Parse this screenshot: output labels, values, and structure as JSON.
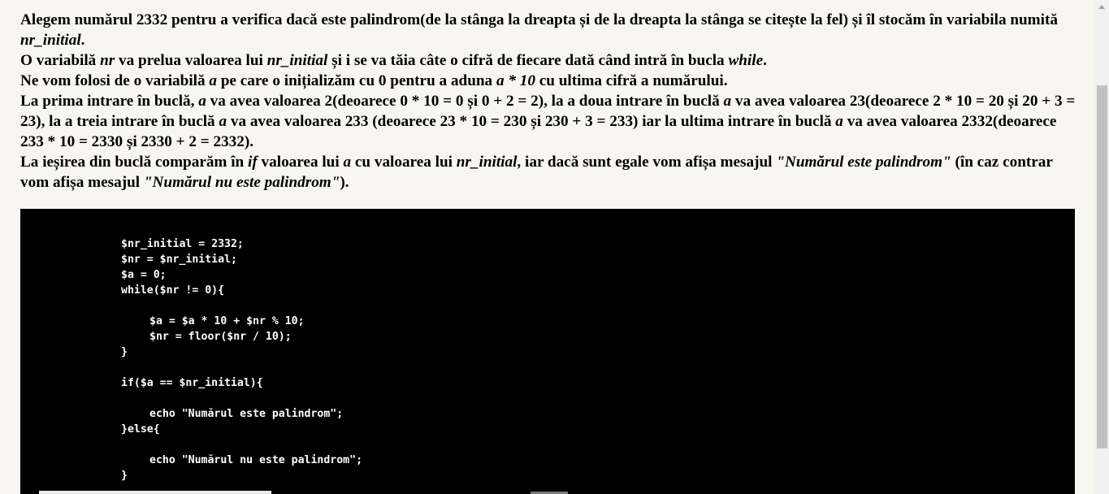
{
  "article": {
    "p1": {
      "a": "Alegem numărul 2332 pentru a verifica dacă este palindrom(de la stânga la dreapta și de la dreapta la stânga se citește la fel) și îl stocăm în variabila numită ",
      "b": "nr_initial",
      "c": "."
    },
    "p2": {
      "a": "O variabilă ",
      "b": "nr",
      "c": " va prelua valoarea lui ",
      "d": "nr_initial",
      "e": " și i se va tăia câte o cifră de fiecare dată când intră în bucla ",
      "f": "while",
      "g": "."
    },
    "p3": {
      "a": "Ne vom folosi de o variabilă ",
      "b": "a",
      "c": " pe care o inițializăm cu 0 pentru a aduna ",
      "d": "a * 10",
      "e": " cu ultima cifră a numărului."
    },
    "p4": {
      "a": "La prima intrare în buclă, ",
      "b": "a",
      "c": " va avea valoarea 2(deoarece 0 * 10 = 0 și 0 + 2 = 2), la a doua intrare în buclă ",
      "d": "a",
      "e": " va avea valoarea 23(deoarece 2 * 10 = 20 și 20 + 3 = 23), la a treia intrare în buclă ",
      "f": "a",
      "g": " va avea valoarea 233 (deoarece 23 * 10 = 230 și 230 + 3 = 233) iar la ultima intrare în buclă ",
      "h": "a",
      "i": " va avea valoarea 2332(deoarece 233 * 10 = 2330 și 2330 + 2 = 2332)."
    },
    "p5": {
      "a": "La ieșirea din buclă comparăm în ",
      "b": "if",
      "c": " valoarea lui ",
      "d": "a",
      "e": " cu valoarea lui ",
      "f": "nr_initial",
      "g": ", iar dacă sunt egale vom afișa mesajul ",
      "h": "\"Numărul este palindrom\"",
      "i": " (în caz contrar vom afișa mesajul ",
      "j": "\"Numărul nu este palindrom\"",
      "k": ")."
    }
  },
  "code": {
    "lines": [
      "$nr_initial = 2332;",
      "$nr = $nr_initial;",
      "$a = 0;",
      "while($nr != 0){",
      "",
      "$a = $a * 10 + $nr % 10;",
      "$nr = floor($nr / 10);",
      "}",
      "",
      "if($a == $nr_initial){",
      "",
      "echo \"Numărul este palindrom\";",
      "}else{",
      "",
      "echo \"Numărul nu este palindrom\";",
      "}"
    ]
  },
  "colors": {
    "page_background": "#f7f6f2",
    "code_background": "#000000",
    "code_text": "#ffffff",
    "text": "#000000"
  }
}
